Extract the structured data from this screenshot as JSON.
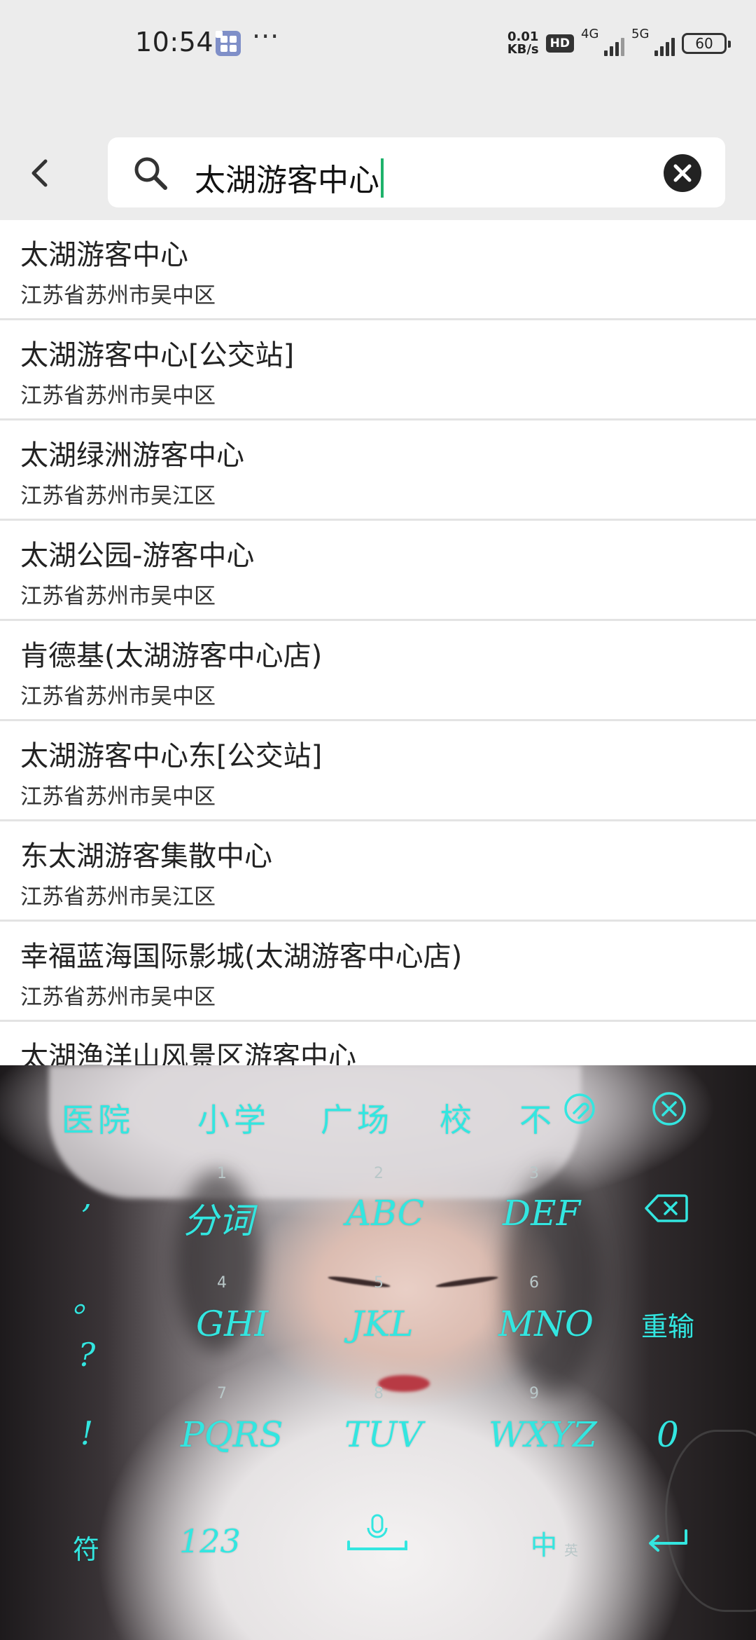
{
  "status_bar": {
    "time": "10:54",
    "more": "···",
    "net_speed_value": "0.01",
    "net_speed_unit": "KB/s",
    "hd_badge": "HD",
    "sim1_label": "4G",
    "sim2_label": "5G",
    "battery": "60"
  },
  "search": {
    "query": "太湖游客中心",
    "back_icon": "chevron-left-icon",
    "search_icon": "search-icon",
    "clear_icon": "clear-icon"
  },
  "results": [
    {
      "title": "太湖游客中心",
      "subtitle": "江苏省苏州市吴中区"
    },
    {
      "title": "太湖游客中心[公交站]",
      "subtitle": "江苏省苏州市吴中区"
    },
    {
      "title": "太湖绿洲游客中心",
      "subtitle": "江苏省苏州市吴江区"
    },
    {
      "title": "太湖公园-游客中心",
      "subtitle": "江苏省苏州市吴中区"
    },
    {
      "title": "肯德基(太湖游客中心店)",
      "subtitle": "江苏省苏州市吴中区"
    },
    {
      "title": "太湖游客中心东[公交站]",
      "subtitle": "江苏省苏州市吴中区"
    },
    {
      "title": "东太湖游客集散中心",
      "subtitle": "江苏省苏州市吴江区"
    },
    {
      "title": "幸福蓝海国际影城(太湖游客中心店)",
      "subtitle": "江苏省苏州市吴中区"
    },
    {
      "title": "太湖渔洋山风景区游客中心",
      "subtitle": ""
    }
  ],
  "keyboard": {
    "accent_color": "#33e6e0",
    "suggestions": [
      "医院",
      "小学",
      "广场",
      "校",
      "不"
    ],
    "punctuation": [
      ",",
      "。",
      "?",
      "!"
    ],
    "keys": {
      "row1": [
        {
          "num": "1",
          "label": "分词"
        },
        {
          "num": "2",
          "label": "ABC"
        },
        {
          "num": "3",
          "label": "DEF"
        }
      ],
      "row2": [
        {
          "num": "4",
          "label": "GHI"
        },
        {
          "num": "5",
          "label": "JKL"
        },
        {
          "num": "6",
          "label": "MNO"
        }
      ],
      "row3": [
        {
          "num": "7",
          "label": "PQRS"
        },
        {
          "num": "8",
          "label": "TUV"
        },
        {
          "num": "9",
          "label": "WXYZ"
        }
      ]
    },
    "retype": "重输",
    "zero": "0",
    "symbols": "符",
    "numbers": "123",
    "lang": "中",
    "lang_sub": "英"
  }
}
